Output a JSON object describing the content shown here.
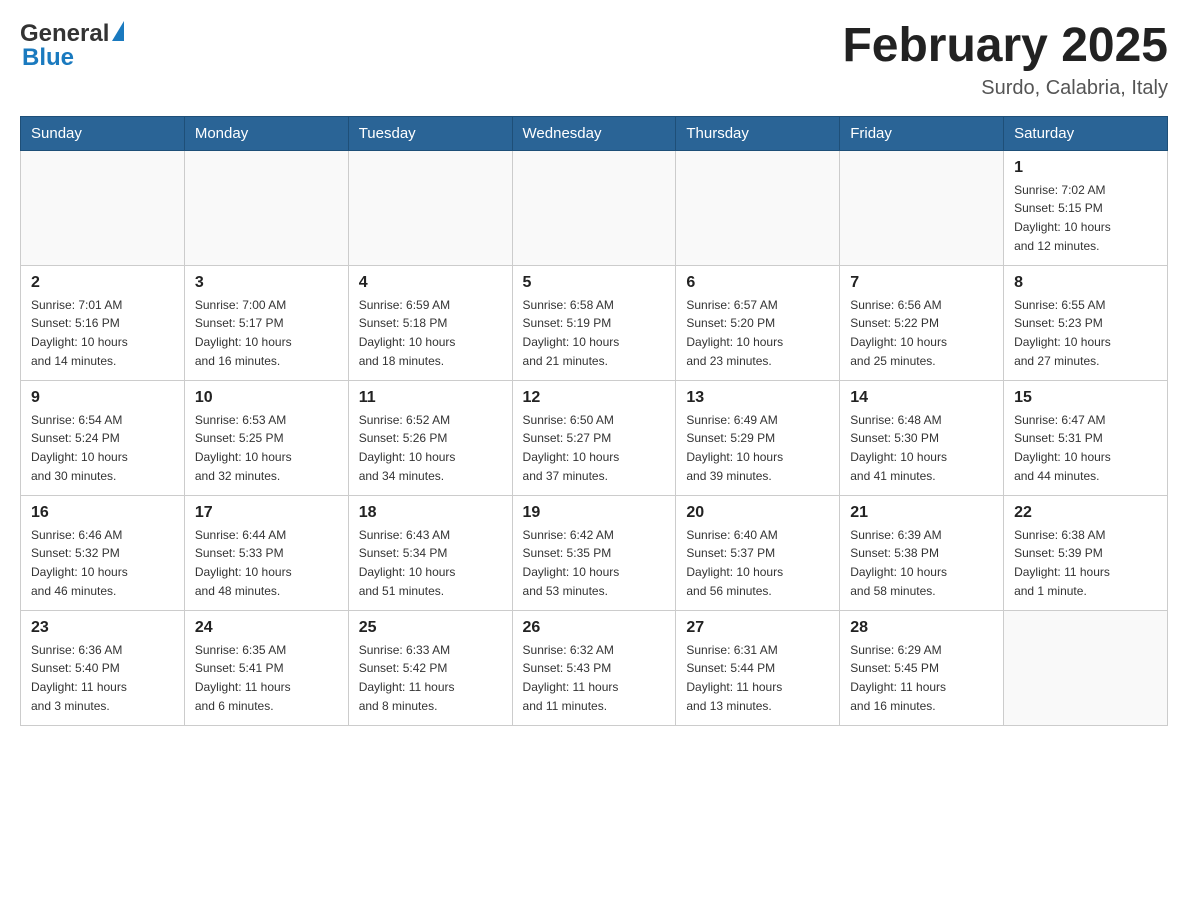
{
  "header": {
    "logo_general": "General",
    "logo_blue": "Blue",
    "month_title": "February 2025",
    "location": "Surdo, Calabria, Italy"
  },
  "calendar": {
    "days_of_week": [
      "Sunday",
      "Monday",
      "Tuesday",
      "Wednesday",
      "Thursday",
      "Friday",
      "Saturday"
    ],
    "weeks": [
      {
        "days": [
          {
            "date": "",
            "info": ""
          },
          {
            "date": "",
            "info": ""
          },
          {
            "date": "",
            "info": ""
          },
          {
            "date": "",
            "info": ""
          },
          {
            "date": "",
            "info": ""
          },
          {
            "date": "",
            "info": ""
          },
          {
            "date": "1",
            "info": "Sunrise: 7:02 AM\nSunset: 5:15 PM\nDaylight: 10 hours\nand 12 minutes."
          }
        ]
      },
      {
        "days": [
          {
            "date": "2",
            "info": "Sunrise: 7:01 AM\nSunset: 5:16 PM\nDaylight: 10 hours\nand 14 minutes."
          },
          {
            "date": "3",
            "info": "Sunrise: 7:00 AM\nSunset: 5:17 PM\nDaylight: 10 hours\nand 16 minutes."
          },
          {
            "date": "4",
            "info": "Sunrise: 6:59 AM\nSunset: 5:18 PM\nDaylight: 10 hours\nand 18 minutes."
          },
          {
            "date": "5",
            "info": "Sunrise: 6:58 AM\nSunset: 5:19 PM\nDaylight: 10 hours\nand 21 minutes."
          },
          {
            "date": "6",
            "info": "Sunrise: 6:57 AM\nSunset: 5:20 PM\nDaylight: 10 hours\nand 23 minutes."
          },
          {
            "date": "7",
            "info": "Sunrise: 6:56 AM\nSunset: 5:22 PM\nDaylight: 10 hours\nand 25 minutes."
          },
          {
            "date": "8",
            "info": "Sunrise: 6:55 AM\nSunset: 5:23 PM\nDaylight: 10 hours\nand 27 minutes."
          }
        ]
      },
      {
        "days": [
          {
            "date": "9",
            "info": "Sunrise: 6:54 AM\nSunset: 5:24 PM\nDaylight: 10 hours\nand 30 minutes."
          },
          {
            "date": "10",
            "info": "Sunrise: 6:53 AM\nSunset: 5:25 PM\nDaylight: 10 hours\nand 32 minutes."
          },
          {
            "date": "11",
            "info": "Sunrise: 6:52 AM\nSunset: 5:26 PM\nDaylight: 10 hours\nand 34 minutes."
          },
          {
            "date": "12",
            "info": "Sunrise: 6:50 AM\nSunset: 5:27 PM\nDaylight: 10 hours\nand 37 minutes."
          },
          {
            "date": "13",
            "info": "Sunrise: 6:49 AM\nSunset: 5:29 PM\nDaylight: 10 hours\nand 39 minutes."
          },
          {
            "date": "14",
            "info": "Sunrise: 6:48 AM\nSunset: 5:30 PM\nDaylight: 10 hours\nand 41 minutes."
          },
          {
            "date": "15",
            "info": "Sunrise: 6:47 AM\nSunset: 5:31 PM\nDaylight: 10 hours\nand 44 minutes."
          }
        ]
      },
      {
        "days": [
          {
            "date": "16",
            "info": "Sunrise: 6:46 AM\nSunset: 5:32 PM\nDaylight: 10 hours\nand 46 minutes."
          },
          {
            "date": "17",
            "info": "Sunrise: 6:44 AM\nSunset: 5:33 PM\nDaylight: 10 hours\nand 48 minutes."
          },
          {
            "date": "18",
            "info": "Sunrise: 6:43 AM\nSunset: 5:34 PM\nDaylight: 10 hours\nand 51 minutes."
          },
          {
            "date": "19",
            "info": "Sunrise: 6:42 AM\nSunset: 5:35 PM\nDaylight: 10 hours\nand 53 minutes."
          },
          {
            "date": "20",
            "info": "Sunrise: 6:40 AM\nSunset: 5:37 PM\nDaylight: 10 hours\nand 56 minutes."
          },
          {
            "date": "21",
            "info": "Sunrise: 6:39 AM\nSunset: 5:38 PM\nDaylight: 10 hours\nand 58 minutes."
          },
          {
            "date": "22",
            "info": "Sunrise: 6:38 AM\nSunset: 5:39 PM\nDaylight: 11 hours\nand 1 minute."
          }
        ]
      },
      {
        "days": [
          {
            "date": "23",
            "info": "Sunrise: 6:36 AM\nSunset: 5:40 PM\nDaylight: 11 hours\nand 3 minutes."
          },
          {
            "date": "24",
            "info": "Sunrise: 6:35 AM\nSunset: 5:41 PM\nDaylight: 11 hours\nand 6 minutes."
          },
          {
            "date": "25",
            "info": "Sunrise: 6:33 AM\nSunset: 5:42 PM\nDaylight: 11 hours\nand 8 minutes."
          },
          {
            "date": "26",
            "info": "Sunrise: 6:32 AM\nSunset: 5:43 PM\nDaylight: 11 hours\nand 11 minutes."
          },
          {
            "date": "27",
            "info": "Sunrise: 6:31 AM\nSunset: 5:44 PM\nDaylight: 11 hours\nand 13 minutes."
          },
          {
            "date": "28",
            "info": "Sunrise: 6:29 AM\nSunset: 5:45 PM\nDaylight: 11 hours\nand 16 minutes."
          },
          {
            "date": "",
            "info": ""
          }
        ]
      }
    ]
  }
}
